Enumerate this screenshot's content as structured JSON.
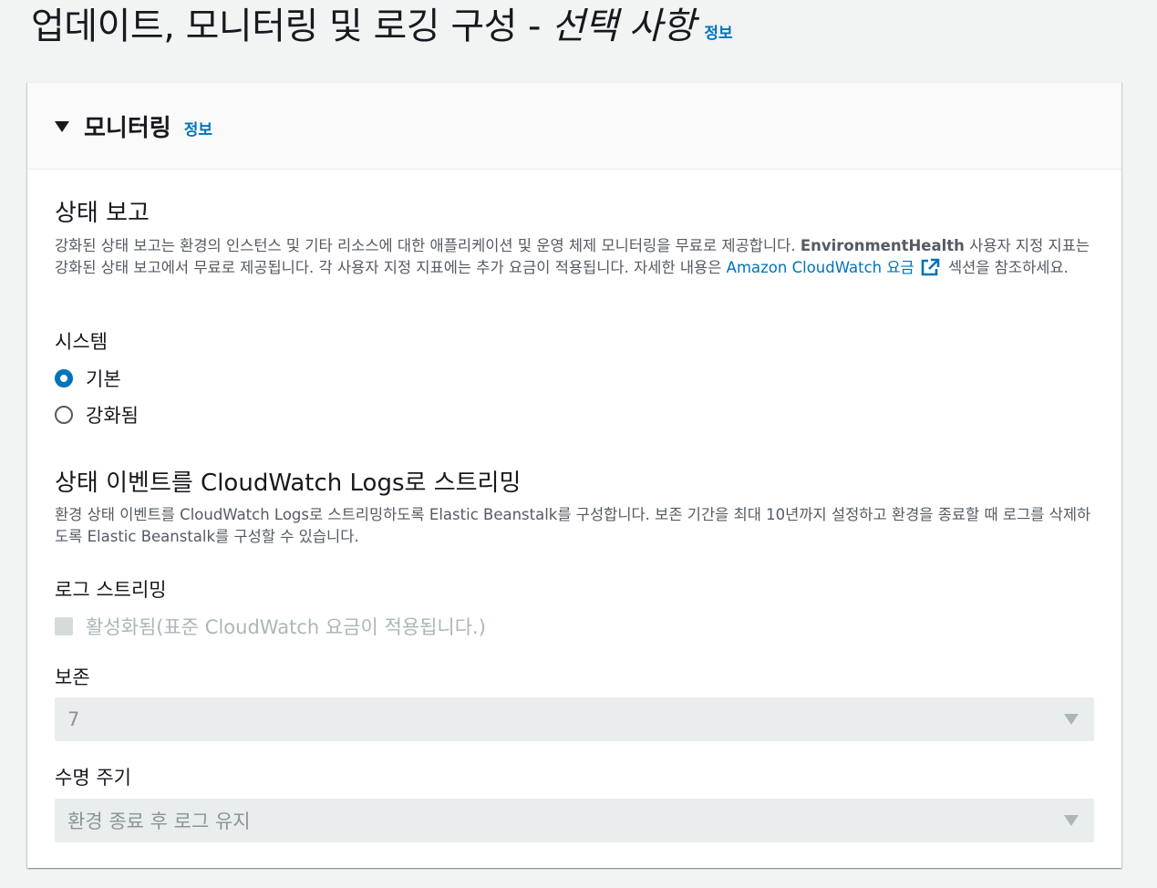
{
  "page": {
    "title_main": "업데이트, 모니터링 및 로깅 구성",
    "title_separator": "-",
    "title_optional": "선택 사항",
    "info_label": "정보"
  },
  "monitoring": {
    "header_title": "모니터링",
    "header_info": "정보",
    "health": {
      "title": "상태 보고",
      "desc_part1": "강화된 상태 보고는 환경의 인스턴스 및 기타 리소스에 대한 애플리케이션 및 운영 체제 모니터링을 무료로 제공합니다. ",
      "desc_bold": "EnvironmentHealth",
      "desc_part2": " 사용자 지정 지표는 강화된 상태 보고에서 무료로 제공됩니다. 각 사용자 지정 지표에는 추가 요금이 적용됩니다. 자세한 내용은 ",
      "desc_link": "Amazon CloudWatch 요금",
      "desc_part3": " 섹션을 참조하세요."
    },
    "system": {
      "label": "시스템",
      "options": [
        {
          "label": "기본",
          "selected": true
        },
        {
          "label": "강화됨",
          "selected": false
        }
      ]
    },
    "streaming": {
      "title": "상태 이벤트를 CloudWatch Logs로 스트리밍",
      "desc": "환경 상태 이벤트를 CloudWatch Logs로 스트리밍하도록 Elastic Beanstalk를 구성합니다. 보존 기간을 최대 10년까지 설정하고 환경을 종료할 때 로그를 삭제하도록 Elastic Beanstalk를 구성할 수 있습니다."
    },
    "log_streaming": {
      "label": "로그 스트리밍",
      "checkbox_label": "활성화됨(표준 CloudWatch 요금이 적용됩니다.)",
      "checked": false,
      "disabled": true
    },
    "retention": {
      "label": "보존",
      "value": "7"
    },
    "lifecycle": {
      "label": "수명 주기",
      "value": "환경 종료 후 로그 유지"
    }
  },
  "colors": {
    "link": "#0073bb",
    "text": "#16191f",
    "muted": "#545b64",
    "disabled_text": "#aab7b8",
    "page_bg": "#f2f3f3",
    "header_bg": "#fafafa",
    "select_bg": "#eaeded"
  },
  "icons": [
    "caret-down-icon",
    "external-link-icon",
    "select-caret-icon"
  ]
}
